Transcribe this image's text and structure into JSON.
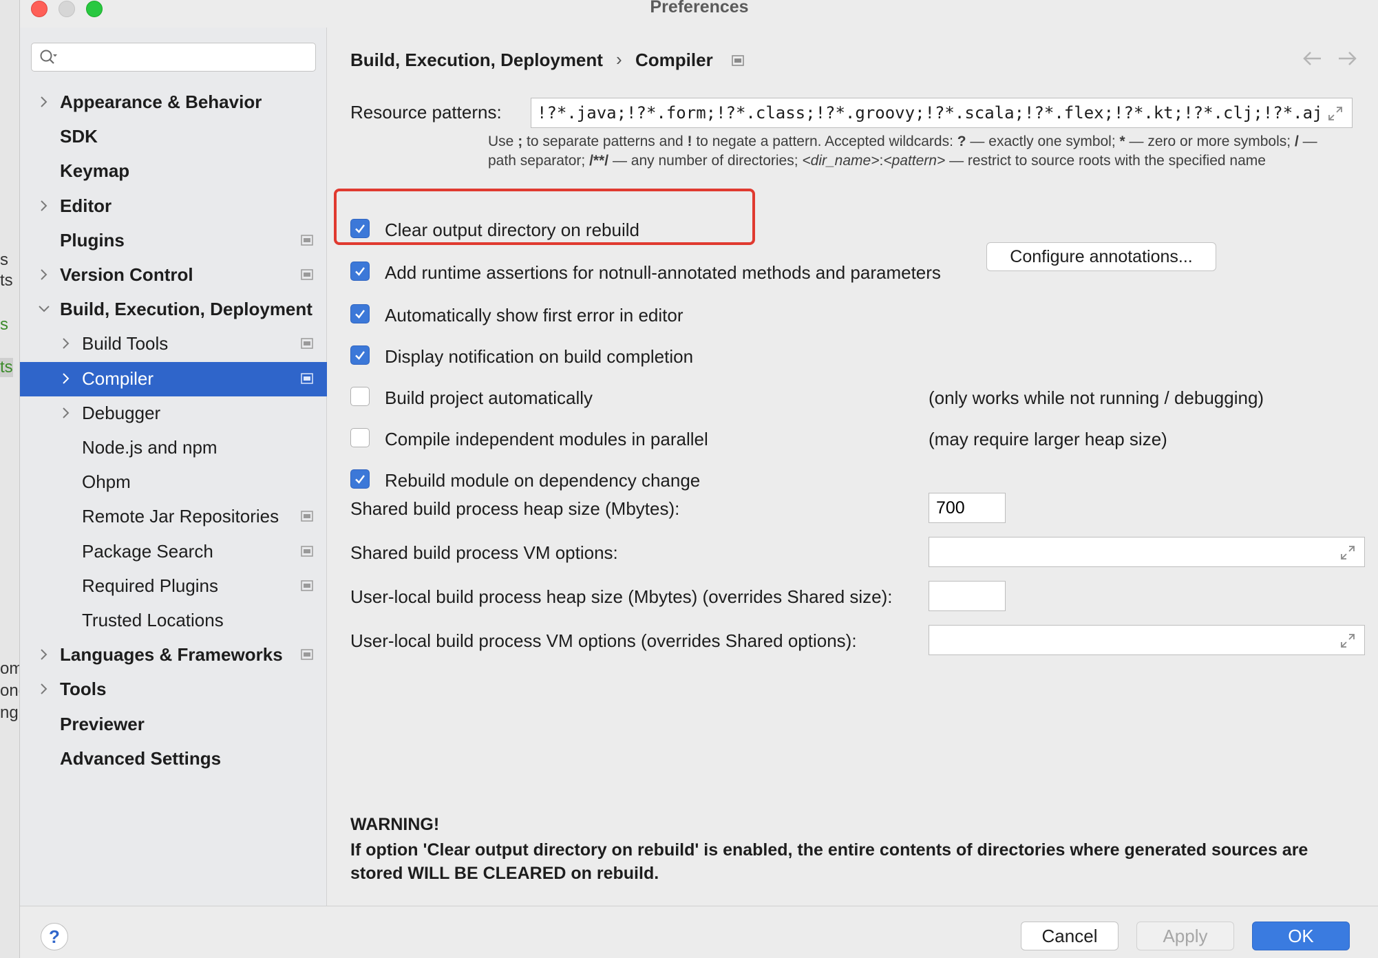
{
  "window": {
    "title": "Preferences"
  },
  "background_fragments": [
    "s",
    "ts",
    "s",
    "ts",
    "om",
    "ong",
    "ng"
  ],
  "sidebar": {
    "search": {
      "value": "",
      "placeholder": ""
    },
    "items": [
      {
        "label": "Appearance & Behavior",
        "level": 0,
        "chevron": "right",
        "project_icon": false,
        "selected": false
      },
      {
        "label": "SDK",
        "level": 0,
        "chevron": "none",
        "project_icon": false,
        "selected": false
      },
      {
        "label": "Keymap",
        "level": 0,
        "chevron": "none",
        "project_icon": false,
        "selected": false
      },
      {
        "label": "Editor",
        "level": 0,
        "chevron": "right",
        "project_icon": false,
        "selected": false
      },
      {
        "label": "Plugins",
        "level": 0,
        "chevron": "none",
        "project_icon": true,
        "selected": false
      },
      {
        "label": "Version Control",
        "level": 0,
        "chevron": "right",
        "project_icon": true,
        "selected": false
      },
      {
        "label": "Build, Execution, Deployment",
        "level": 0,
        "chevron": "down",
        "project_icon": false,
        "selected": false
      },
      {
        "label": "Build Tools",
        "level": 1,
        "chevron": "right",
        "project_icon": true,
        "selected": false
      },
      {
        "label": "Compiler",
        "level": 1,
        "chevron": "right",
        "project_icon": true,
        "selected": true
      },
      {
        "label": "Debugger",
        "level": 1,
        "chevron": "right",
        "project_icon": false,
        "selected": false
      },
      {
        "label": "Node.js and npm",
        "level": 1,
        "chevron": "none",
        "project_icon": false,
        "selected": false
      },
      {
        "label": "Ohpm",
        "level": 1,
        "chevron": "none",
        "project_icon": false,
        "selected": false
      },
      {
        "label": "Remote Jar Repositories",
        "level": 1,
        "chevron": "none",
        "project_icon": true,
        "selected": false
      },
      {
        "label": "Package Search",
        "level": 1,
        "chevron": "none",
        "project_icon": true,
        "selected": false
      },
      {
        "label": "Required Plugins",
        "level": 1,
        "chevron": "none",
        "project_icon": true,
        "selected": false
      },
      {
        "label": "Trusted Locations",
        "level": 1,
        "chevron": "none",
        "project_icon": false,
        "selected": false
      },
      {
        "label": "Languages & Frameworks",
        "level": 0,
        "chevron": "right",
        "project_icon": true,
        "selected": false
      },
      {
        "label": "Tools",
        "level": 0,
        "chevron": "right",
        "project_icon": false,
        "selected": false
      },
      {
        "label": "Previewer",
        "level": 0,
        "chevron": "none",
        "project_icon": false,
        "selected": false
      },
      {
        "label": "Advanced Settings",
        "level": 0,
        "chevron": "none",
        "project_icon": false,
        "selected": false
      }
    ]
  },
  "breadcrumb": {
    "parent": "Build, Execution, Deployment",
    "separator": "›",
    "current": "Compiler"
  },
  "resource_patterns": {
    "label": "Resource patterns:",
    "value": "!?*.java;!?*.form;!?*.class;!?*.groovy;!?*.scala;!?*.flex;!?*.kt;!?*.clj;!?*.aj"
  },
  "hint": {
    "p1": "Use ",
    "b1": ";",
    "p2": " to separate patterns and ",
    "b2": "!",
    "p3": " to negate a pattern. Accepted wildcards: ",
    "b3": "?",
    "p4": " — exactly one symbol; ",
    "b4": "*",
    "p5": " — zero or more symbols; ",
    "b5": "/",
    "p6": " — path separator; ",
    "b6": "/**/",
    "p7": " — any number of directories; ",
    "i1": "<dir_name>",
    "p8": ":",
    "i2": "<pattern>",
    "p9": " — restrict to source roots with the specified name"
  },
  "options": [
    {
      "label": "Clear output directory on rebuild",
      "checked": true,
      "note": ""
    },
    {
      "label": "Add runtime assertions for notnull-annotated methods and parameters",
      "checked": true,
      "note": ""
    },
    {
      "label": "Automatically show first error in editor",
      "checked": true,
      "note": ""
    },
    {
      "label": "Display notification on build completion",
      "checked": true,
      "note": ""
    },
    {
      "label": "Build project automatically",
      "checked": false,
      "note": "(only works while not running / debugging)"
    },
    {
      "label": "Compile independent modules in parallel",
      "checked": false,
      "note": "(may require larger heap size)"
    },
    {
      "label": "Rebuild module on dependency change",
      "checked": true,
      "note": ""
    }
  ],
  "configure_annotations_label": "Configure annotations...",
  "fields": {
    "shared_heap": {
      "label": "Shared build process heap size (Mbytes):",
      "value": "700"
    },
    "shared_vm": {
      "label": "Shared build process VM options:",
      "value": ""
    },
    "local_heap": {
      "label": "User-local build process heap size (Mbytes) (overrides Shared size):",
      "value": ""
    },
    "local_vm": {
      "label": "User-local build process VM options (overrides Shared options):",
      "value": ""
    }
  },
  "warning": {
    "title": "WARNING!",
    "text": "If option 'Clear output directory on rebuild' is enabled, the entire contents of directories where generated sources are stored WILL BE CLEARED on rebuild."
  },
  "footer": {
    "help": "?",
    "cancel": "Cancel",
    "apply": "Apply",
    "ok": "OK"
  },
  "colors": {
    "selection": "#2f65ca",
    "checkbox": "#3c78d8",
    "highlight": "#e03a30",
    "ok_button": "#3a7be0"
  }
}
